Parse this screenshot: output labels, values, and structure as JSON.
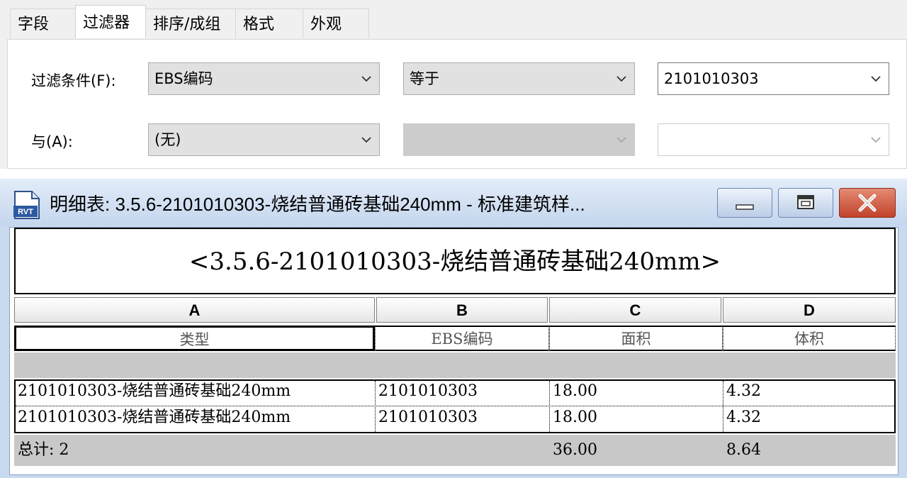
{
  "dialog": {
    "tabs": [
      "字段",
      "过滤器",
      "排序/成组",
      "格式",
      "外观"
    ],
    "active_tab": "过滤器",
    "filter_label": "过滤条件(F):",
    "filter_field": "EBS编码",
    "filter_operator": "等于",
    "filter_value": "2101010303",
    "and_label": "与(A):",
    "and_field": "(无)",
    "and_operator": "",
    "and_value": ""
  },
  "window": {
    "icon_text": "RVT",
    "title": "明细表: 3.5.6-2101010303-烧结普通砖基础240mm - 标准建筑样...",
    "buttons": [
      "minimize",
      "restore",
      "close"
    ]
  },
  "schedule": {
    "title": "<3.5.6-2101010303-烧结普通砖基础240mm>",
    "column_letters": [
      "A",
      "B",
      "C",
      "D"
    ],
    "column_headers": [
      "类型",
      "EBS编码",
      "面积",
      "体积"
    ],
    "rows": [
      [
        "2101010303-烧结普通砖基础240mm",
        "2101010303",
        "18.00",
        "4.32"
      ],
      [
        "2101010303-烧结普通砖基础240mm",
        "2101010303",
        "18.00",
        "4.32"
      ]
    ],
    "total_label": "总计: 2",
    "total_area": "36.00",
    "total_volume": "8.64"
  },
  "colors": {
    "title_gradient_top": "#e3ecf8",
    "title_gradient_bottom": "#c4d6ee",
    "close_button": "#c2432a",
    "gray_band": "#c8c8c8"
  }
}
